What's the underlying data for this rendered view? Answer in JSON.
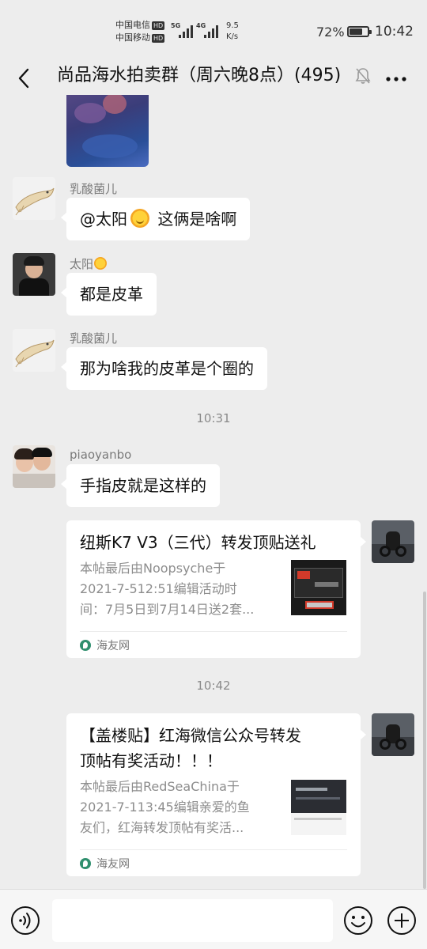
{
  "status_bar": {
    "carrier_top": "中国电信",
    "carrier_bottom": "中国移动",
    "hd_label": "HD",
    "net_1": "5G",
    "net_2": "4G",
    "speed_value": "9.5",
    "speed_unit": "K/s",
    "battery_percent": "72%",
    "battery_level": 0.72,
    "time": "10:42"
  },
  "header": {
    "title": "尚品海水拍卖群（周六晚8点）(495)"
  },
  "messages": [
    {
      "sender": "乳酸菌儿",
      "text_prefix": "@太阳",
      "text_suffix": " 这俩是啥啊"
    },
    {
      "sender": "太阳",
      "text": "都是皮革"
    },
    {
      "sender": "乳酸菌儿",
      "text": "那为啥我的皮革是个圈的"
    },
    {
      "sender": "piaoyanbo",
      "text": "手指皮就是这样的"
    }
  ],
  "timestamps": [
    "10:31",
    "10:42"
  ],
  "cards": [
    {
      "title": "纽斯K7 V3（三代）转发顶贴送礼",
      "desc_lines": [
        "本帖最后由Noopsyche于",
        "2021-7-512:51编辑活动时",
        "间：7月5日到7月14日送2套..."
      ],
      "source": "海友网"
    },
    {
      "title_lines": [
        "【盖楼贴】红海微信公众号转发",
        "顶帖有奖活动！！！"
      ],
      "desc_lines": [
        "本帖最后由RedSeaChina于",
        "2021-7-113:45编辑亲爱的鱼",
        "友们，红海转发顶帖有奖活..."
      ],
      "source": "海友网"
    }
  ],
  "colors": {
    "background": "#ededed",
    "bubble": "#ffffff",
    "meta_text": "#8a8a8a"
  }
}
